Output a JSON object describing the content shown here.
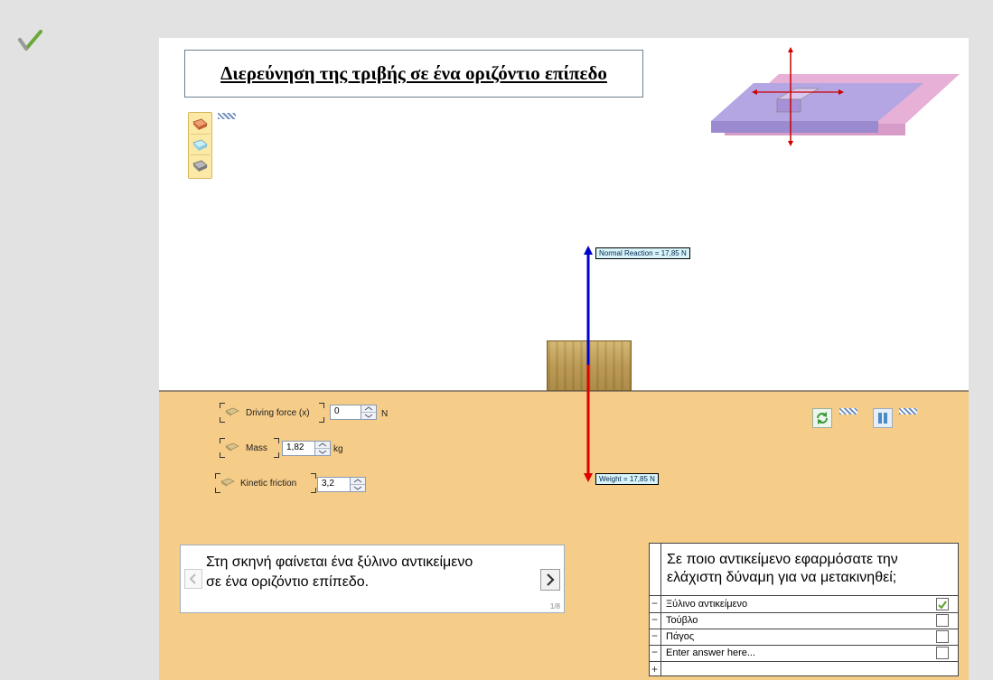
{
  "sidebar": {
    "check_icon": "green-check-icon"
  },
  "scene": {
    "title": "Διερεύνηση της τριβής σε ένα οριζόντιο επίπεδο",
    "materials": [
      "brick-icon",
      "ice-icon",
      "stone-icon"
    ],
    "normal_label": "Normal Reaction = 17,85 N",
    "weight_label": "Weight = 17,85 N",
    "arrow_colors": {
      "normal": "#0000cc",
      "weight": "#e00000"
    }
  },
  "controls": {
    "driving_force": {
      "label": "Driving force (x)",
      "value": "0",
      "unit": "N"
    },
    "mass": {
      "label": "Mass",
      "value": "1,82",
      "unit": "kg"
    },
    "kinetic_friction": {
      "label": "Kinetic friction",
      "value": "3,2"
    }
  },
  "text_panel": {
    "line1": "Στη  σκηνή φαίνεται  ένα ξύλινο αντικείμενο",
    "line2": "σε ένα οριζόντιο επίπεδο.",
    "page": "1/8"
  },
  "question": {
    "text": "Σε ποιο αντικείμενο εφαρμόσατε την ελάχιστη δύναμη για να μετακινηθεί;",
    "answers": [
      {
        "label": "Ξύλινο αντικείμενο",
        "checked": true
      },
      {
        "label": "Τούβλο",
        "checked": false
      },
      {
        "label": "Πάγος",
        "checked": false
      },
      {
        "label": "Enter answer here...",
        "checked": false
      }
    ],
    "add_symbol": "+",
    "minus_symbol": "−"
  }
}
